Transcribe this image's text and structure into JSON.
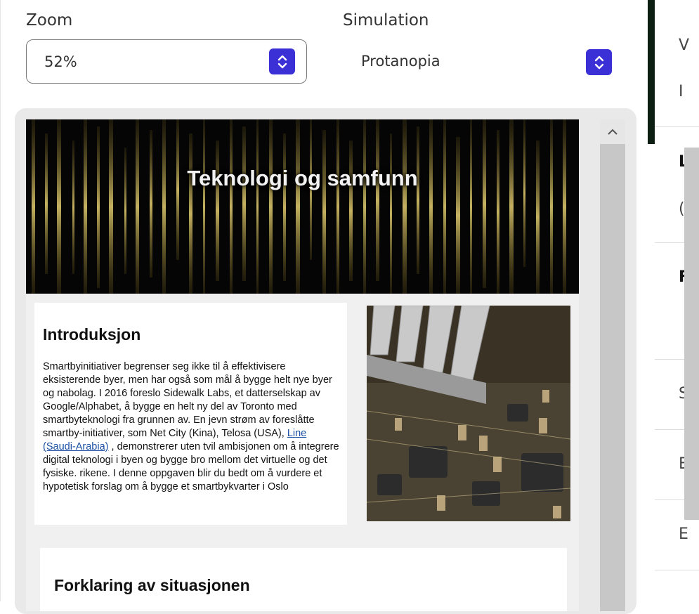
{
  "zoom": {
    "label": "Zoom",
    "value": "52%"
  },
  "simulation": {
    "label": "Simulation",
    "value": "Protanopia"
  },
  "document": {
    "banner_title": "Teknologi og samfunn",
    "intro": {
      "title": "Introduksjon",
      "text_before_link": "Smartbyinitiativer begrenser seg ikke til å effektivisere eksisterende byer, men har også som mål å bygge helt nye byer og nabolag. I 2016 foreslo Sidewalk Labs, et datterselskap av Google/Alphabet, å bygge en helt ny del av Toronto med smartbyteknologi fra grunnen av. En jevn strøm av foreslåtte smartby-initiativer, som Net City (Kina), Telosa (USA), ",
      "link_text": "Line (Saudi-Arabia)",
      "text_after_link": " , demonstrerer uten tvil ambisjonen om å integrere digital teknologi i byen og bygge bro mellom det virtuelle og det fysiske. rikene. I denne oppgaven blir du bedt om å vurdere et hypotetisk forslag om å bygge et smartbykvarter i Oslo"
    },
    "section2_title": "Forklaring av situasjonen"
  },
  "right_edge_letters": [
    "V",
    "I",
    "L",
    "(",
    "F",
    "S",
    "E",
    "E"
  ],
  "colors": {
    "accent": "#3b2fd6",
    "link": "#1a4fa3"
  }
}
